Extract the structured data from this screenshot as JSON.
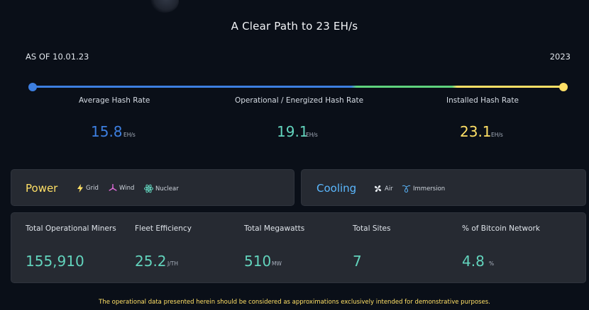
{
  "header": {
    "title": "A Clear Path to 23 EH/s",
    "as_of": "AS OF 10.01.23",
    "year": "2023"
  },
  "hash_rates": [
    {
      "label": "Average Hash Rate",
      "value": "15.8",
      "unit": "EH/s",
      "color": "#3d7fe0"
    },
    {
      "label": "Operational / Energized Hash Rate",
      "value": "19.1",
      "unit": "EH/s",
      "color": "#62d3bc"
    },
    {
      "label": "Installed Hash Rate",
      "value": "23.1",
      "unit": "EH/s",
      "color": "#ffe066"
    }
  ],
  "power": {
    "title": "Power",
    "title_color": "#ffe066",
    "items": [
      {
        "label": "Grid",
        "icon": "lightning-icon"
      },
      {
        "label": "Wind",
        "icon": "wind-turbine-icon"
      },
      {
        "label": "Nuclear",
        "icon": "atom-icon"
      }
    ]
  },
  "cooling": {
    "title": "Cooling",
    "title_color": "#5bb8ff",
    "items": [
      {
        "label": "Air",
        "icon": "fan-icon"
      },
      {
        "label": "Immersion",
        "icon": "water-drop-icon"
      }
    ]
  },
  "stats": [
    {
      "label": "Total Operational Miners",
      "value": "155,910",
      "unit": ""
    },
    {
      "label": "Fleet Efficiency",
      "value": "25.2",
      "unit": "J/TH"
    },
    {
      "label": "Total Megawatts",
      "value": "510",
      "unit": "MW"
    },
    {
      "label": "Total Sites",
      "value": "7",
      "unit": ""
    },
    {
      "label": "% of Bitcoin Network",
      "value": "4.8",
      "unit": "%"
    }
  ],
  "disclaimer": "The operational data presented herein should be considered as approximations exclusively intended for demonstrative purposes."
}
